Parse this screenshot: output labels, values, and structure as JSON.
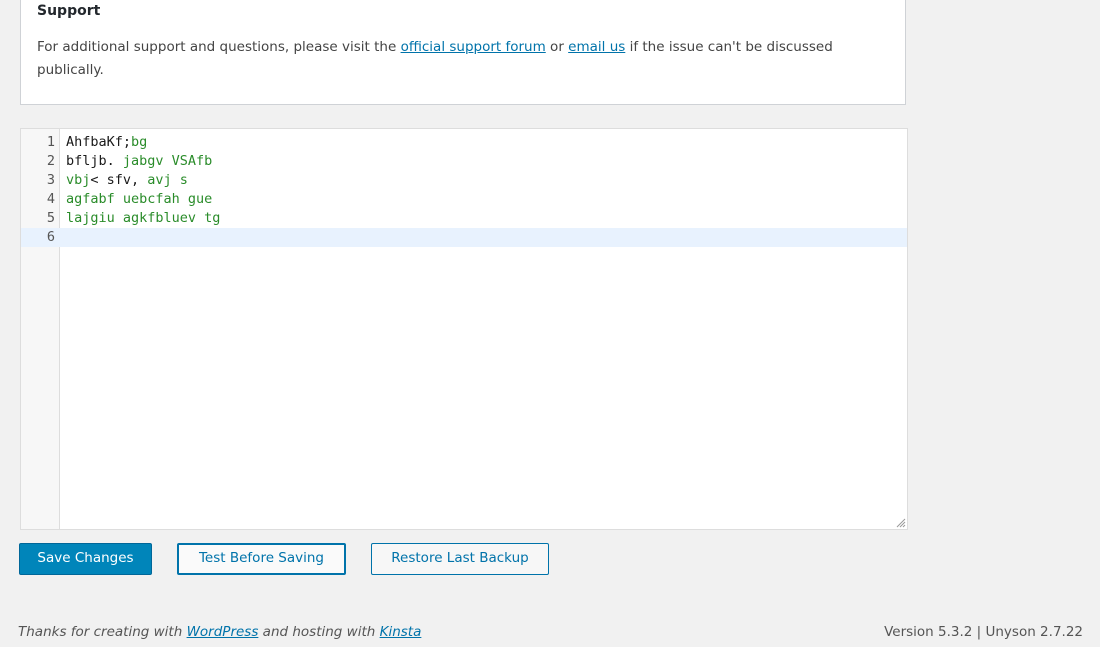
{
  "support": {
    "title": "Support",
    "text_before": "For additional support and questions, please visit the ",
    "forum_link": "official support forum",
    "text_middle": " or ",
    "email_link": "email us",
    "text_after": " if the issue can't be discussed publically."
  },
  "editor": {
    "lines": [
      {
        "num": "1",
        "parts": [
          {
            "text": "AhfbaKf;",
            "style": "plain"
          },
          {
            "text": "bg",
            "style": "green"
          }
        ]
      },
      {
        "num": "2",
        "parts": [
          {
            "text": "bfljb. ",
            "style": "plain"
          },
          {
            "text": "jabgv VSAfb",
            "style": "green"
          }
        ]
      },
      {
        "num": "3",
        "parts": [
          {
            "text": "vbj",
            "style": "green"
          },
          {
            "text": "< sfv, ",
            "style": "plain"
          },
          {
            "text": "avj s",
            "style": "green"
          }
        ]
      },
      {
        "num": "4",
        "parts": [
          {
            "text": "agfabf uebcfah gue",
            "style": "green"
          }
        ]
      },
      {
        "num": "5",
        "parts": [
          {
            "text": "lajgiu agkfbluev tg",
            "style": "green"
          }
        ]
      },
      {
        "num": "6",
        "parts": [
          {
            "text": "",
            "style": "plain"
          }
        ]
      }
    ],
    "active_line": "6"
  },
  "buttons": {
    "save": "Save Changes",
    "test": "Test Before Saving",
    "restore": "Restore Last Backup"
  },
  "footer": {
    "thanks_prefix": "Thanks for creating with ",
    "wordpress_link": "WordPress",
    "hosting_text": " and hosting with ",
    "kinsta_link": "Kinsta",
    "version": "Version 5.3.2 | Unyson 2.7.22"
  },
  "colors": {
    "primary_button": "#0085ba",
    "link": "#0073aa",
    "code_green": "#2a8c2a",
    "active_line_bg": "#e8f2fe"
  }
}
